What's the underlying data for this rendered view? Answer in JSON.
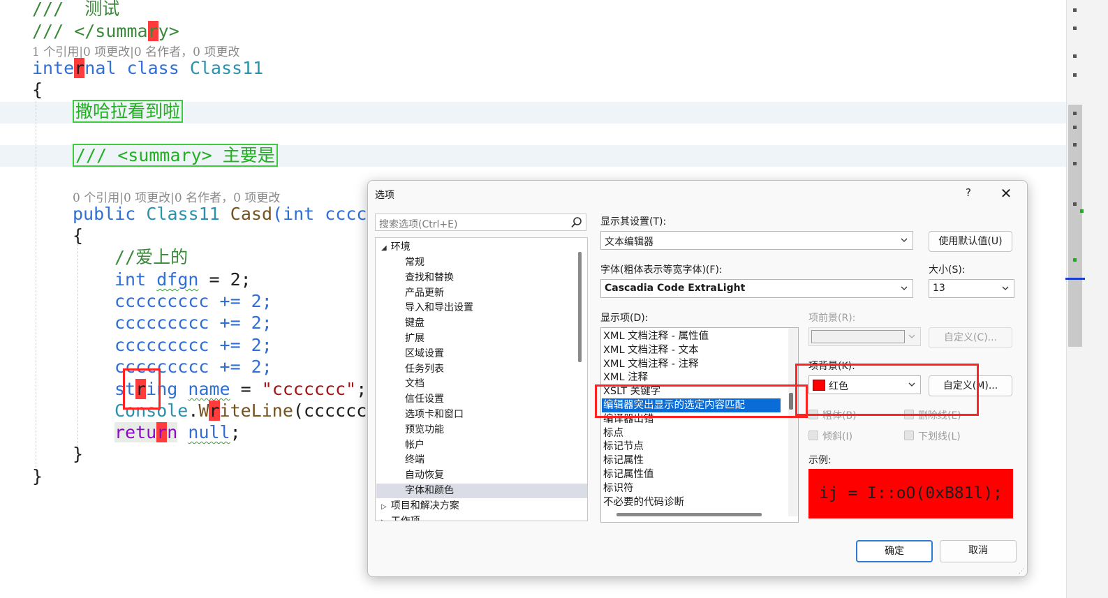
{
  "editor": {
    "lines": {
      "l1": "///  测试",
      "l2a": "/// </summa",
      "l2b": "r",
      "l2c": "y>",
      "lens1": "1 个引用|0 项更改|0 名作者，0 项更改",
      "l3_kw1a": "inte",
      "l3_kw1b": "r",
      "l3_kw1c": "nal",
      "l3_kw2": "class",
      "l3_type": "Class11",
      "l4": "{",
      "l5": "撒哈拉看到啦",
      "l6": "/// <summary> 主要是",
      "lens2": "0 个引用|0 项更改|0 名作者，0 项更改",
      "l7_kw": "public",
      "l7_type": "Class11",
      "l7_method": "Casd",
      "l7_rest": "(int ccccc",
      "l8": "{",
      "l9": "//爱上的",
      "l10_kw": "int",
      "l10_var": "dfgn",
      "l10_rest": " = 2;",
      "l11": "ccccccccc += 2;",
      "l12": "ccccccccc += 2;",
      "l13": "ccccccccc += 2;",
      "l14": "ccccccccc += 2;",
      "l15_kwa": "st",
      "l15_kwb": "r",
      "l15_kwc": "ing",
      "l15_var": "name",
      "l15_eq": " = ",
      "l15_str": "\"ccccccc\"",
      "l15_end": ";",
      "l16_type": "Console",
      "l16_dot": ".",
      "l16_ma": "W",
      "l16_mb": "r",
      "l16_mc": "iteLine",
      "l16_rest": "(cccccc",
      "l17_kwa": "retu",
      "l17_kwb": "r",
      "l17_kwc": "n",
      "l17_null": "null",
      "l17_end": ";",
      "l18": "}",
      "l19": "}"
    }
  },
  "dialog": {
    "title": "选项",
    "help": "?",
    "close": "✕",
    "search_placeholder": "搜索选项(Ctrl+E)",
    "tree": {
      "root": "环境",
      "root_toggle": "◢",
      "children": [
        "常规",
        "查找和替换",
        "产品更新",
        "导入和导出设置",
        "键盘",
        "扩展",
        "区域设置",
        "任务列表",
        "文档",
        "信任设置",
        "选项卡和窗口",
        "预览功能",
        "帐户",
        "终端",
        "自动恢复",
        "字体和颜色"
      ],
      "collapsed": [
        "项目和解决方案",
        "工作项"
      ],
      "collapsed_toggle": "▷"
    },
    "show_settings_label": "显示其设置(T):",
    "show_settings_value": "文本编辑器",
    "use_defaults": "使用默认值(U)",
    "font_label": "字体(粗体表示等宽字体)(F):",
    "font_value": "Cascadia Code ExtraLight",
    "size_label": "大小(S):",
    "size_value": "13",
    "display_items_label": "显示项(D):",
    "display_items": [
      "XML 文档注释 - 属性值",
      "XML 文档注释 - 文本",
      "XML 文档注释 - 注释",
      "XML 注释",
      "XSLT 关键字",
      "编辑器突出显示的选定内容匹配",
      "编译器出错",
      "标点",
      "标记节点",
      "标记属性",
      "标记属性值",
      "标识符",
      "不必要的代码诊断"
    ],
    "selected_index": 5,
    "foreground_label": "项前景(R):",
    "custom_fg": "自定义(C)...",
    "background_label": "项背景(K):",
    "background_value": "红色",
    "custom_bg": "自定义(M)...",
    "bold": "粗体(B)",
    "strikethrough": "删除线(E)",
    "italic": "倾斜(I)",
    "underline": "下划线(L)",
    "sample_label": "示例:",
    "sample_text": "ij = I::oO(0xB81l);",
    "ok": "确定",
    "cancel": "取消"
  },
  "colors": {
    "highlight": "#ff3b3b",
    "annotation": "#ff2222",
    "selection": "#0a6cd6",
    "sample_bg": "#ff0000"
  }
}
